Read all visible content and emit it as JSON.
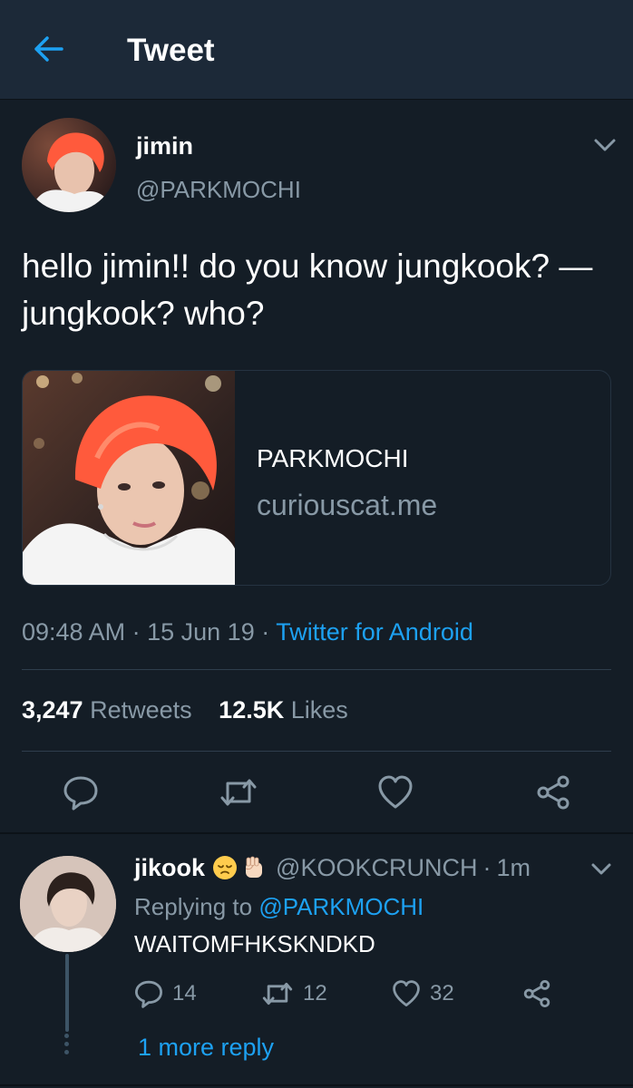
{
  "header": {
    "title": "Tweet",
    "back_icon": "arrow-left-icon"
  },
  "tweet": {
    "author_name": "jimin",
    "author_handle": "@PARKMOCHI",
    "text": "hello jimin!! do you know jungkook? — jungkook? who?",
    "card": {
      "title": "PARKMOCHI",
      "domain": "curiouscat.me"
    },
    "time": "09:48 AM",
    "date": "15 Jun 19",
    "source": "Twitter for Android",
    "separator": "·",
    "retweets_count": "3,247",
    "retweets_label": "Retweets",
    "likes_count": "12.5K",
    "likes_label": "Likes"
  },
  "reply": {
    "author_name": "jikook",
    "author_handle": "@KOOKCRUNCH",
    "time": "1m",
    "replying_prefix": "Replying to",
    "replying_to": "@PARKMOCHI",
    "text": "WAITOMFHKSKNDKD",
    "reply_count": "14",
    "retweet_count": "12",
    "like_count": "32",
    "more_replies": "1 more reply"
  },
  "colors": {
    "background": "#141d26",
    "header_background": "#1c2938",
    "accent": "#1da1f2",
    "muted_text": "#8899a6",
    "divider": "#2f3e4d"
  }
}
